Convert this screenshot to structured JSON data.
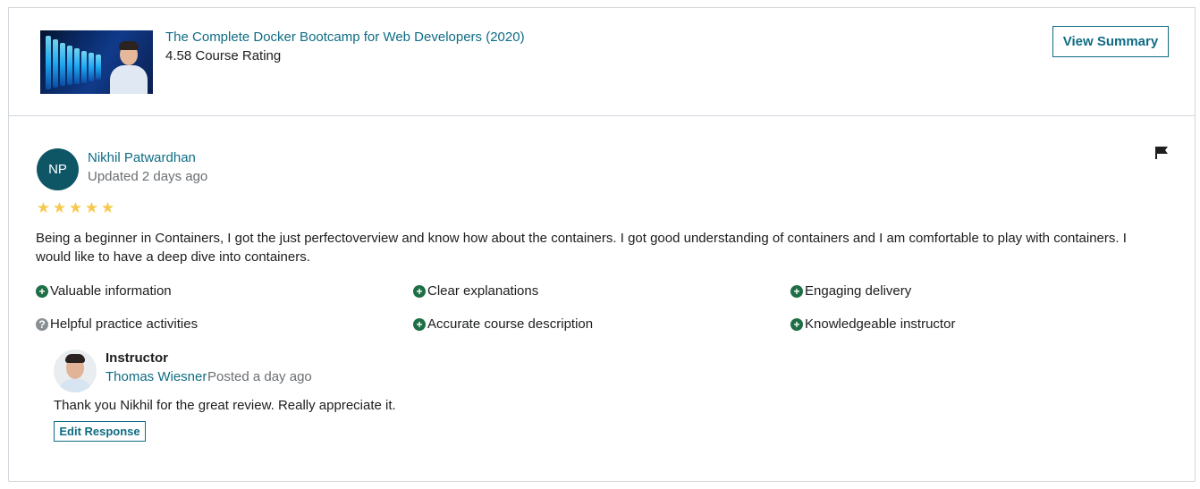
{
  "course": {
    "title": "The Complete Docker Bootcamp for Web Developers (2020)",
    "rating_text": "4.58 Course Rating",
    "view_summary_label": "View Summary"
  },
  "review": {
    "initials": "NP",
    "reviewer_name": "Nikhil Patwardhan",
    "updated_text": "Updated 2 days ago",
    "stars": 5,
    "body": "Being a beginner in Containers, I got the just perfectoverview and know how about the containers. I got good understanding of containers and I am comfortable to play with containers. I would like to have a deep dive into containers.",
    "tags": [
      {
        "label": "Valuable information",
        "icon": "plus-circle-icon"
      },
      {
        "label": "Clear explanations",
        "icon": "plus-circle-icon"
      },
      {
        "label": "Engaging delivery",
        "icon": "plus-circle-icon"
      },
      {
        "label": "Helpful practice activities",
        "icon": "question-circle-icon"
      },
      {
        "label": "Accurate course description",
        "icon": "plus-circle-icon"
      },
      {
        "label": "Knowledgeable instructor",
        "icon": "plus-circle-icon"
      }
    ]
  },
  "response": {
    "role_label": "Instructor",
    "instructor_name": "Thomas Wiesner",
    "posted_text": "Posted a day ago",
    "text": "Thank you Nikhil for the great review. Really appreciate it.",
    "edit_label": "Edit Response"
  },
  "colors": {
    "link": "#0f6c84",
    "star": "#f3ca4d",
    "positive_icon": "#1e6f45",
    "neutral_icon": "#8a8f94",
    "avatar_bg": "#0e5566"
  }
}
